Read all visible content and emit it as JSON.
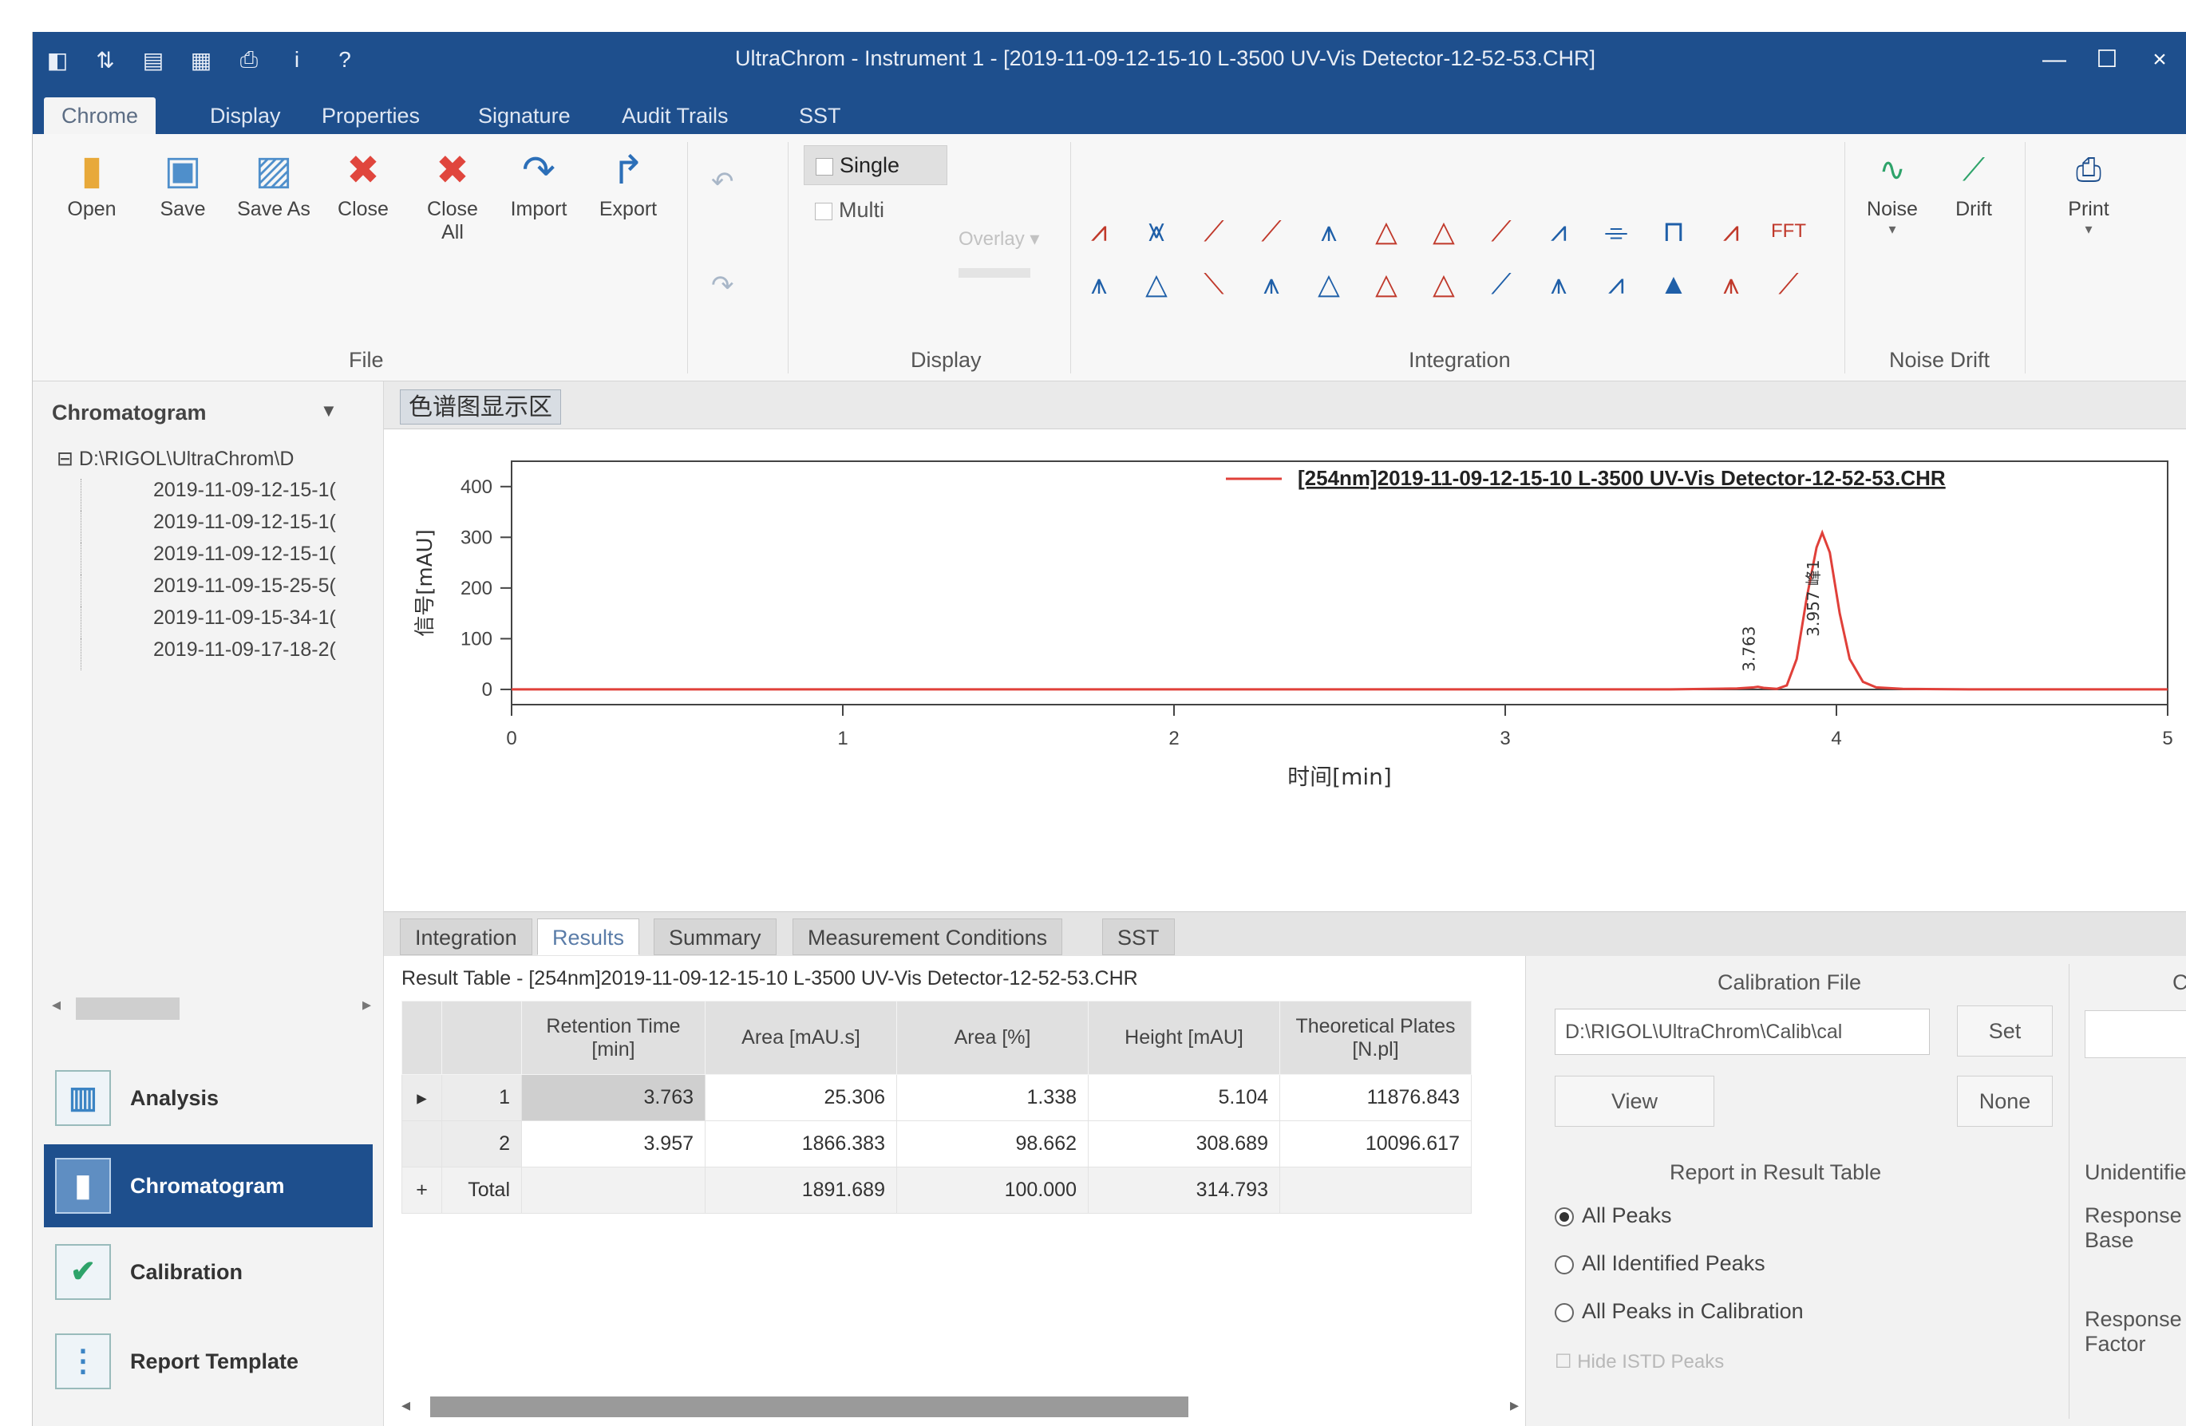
{
  "window": {
    "title": "UltraChrom - Instrument 1 - [2019-11-09-12-15-10 L-3500 UV-Vis Detector-12-52-53.CHR]",
    "qa_icons": [
      "app-icon",
      "new-icon",
      "open-icon",
      "layout-icon",
      "print-icon",
      "info-icon",
      "help-icon"
    ],
    "controls": [
      "—",
      "☐",
      "×"
    ]
  },
  "menu_tabs": [
    "Chrome",
    "Display",
    "Properties",
    "Signature",
    "Audit Trails",
    "SST"
  ],
  "ribbon": {
    "file_buttons": [
      {
        "label": "Open",
        "icon": "open-folder-icon"
      },
      {
        "label": "Save",
        "icon": "save-icon"
      },
      {
        "label": "Save As",
        "icon": "save-as-icon"
      },
      {
        "label": "Close",
        "icon": "close-icon"
      },
      {
        "label": "Close All",
        "icon": "close-all-icon"
      },
      {
        "label": "Import",
        "icon": "import-icon"
      },
      {
        "label": "Export",
        "icon": "export-icon"
      }
    ],
    "file_group": "File",
    "display": {
      "single": "Single",
      "multi": "Multi",
      "overlay": "Overlay",
      "group": "Display"
    },
    "integration_group": "Integration",
    "fft_label": "FFT",
    "noise_buttons": [
      {
        "label": "Noise",
        "icon": "noise-icon"
      },
      {
        "label": "Drift",
        "icon": "drift-icon"
      }
    ],
    "noise_group": "Noise Drift",
    "print": {
      "label": "Print",
      "icon": "print-icon"
    }
  },
  "left_panel": {
    "header": "Chromatogram",
    "tree_root": "D:\\RIGOL\\UltraChrom\\D",
    "tree_items": [
      "2019-11-09-12-15-1(",
      "2019-11-09-12-15-1(",
      "2019-11-09-12-15-1(",
      "2019-11-09-15-25-5(",
      "2019-11-09-15-34-1(",
      "2019-11-09-17-18-2("
    ],
    "nav": [
      {
        "label": "Analysis",
        "icon": "analysis-icon"
      },
      {
        "label": "Chromatogram",
        "icon": "chromatogram-icon"
      },
      {
        "label": "Calibration",
        "icon": "calibration-icon"
      },
      {
        "label": "Report Template",
        "icon": "report-template-icon"
      }
    ]
  },
  "doc_tab": "色谱图显示区",
  "chart_data": {
    "type": "line",
    "title": "",
    "legend": "[254nm]2019-11-09-12-15-10 L-3500 UV-Vis Detector-12-52-53.CHR",
    "legend_position": "top-right",
    "xlabel": "时间[min]",
    "ylabel": "信号[mAU]",
    "xlim": [
      0,
      5
    ],
    "ylim": [
      -30,
      450
    ],
    "x_ticks": [
      0,
      1,
      2,
      3,
      4,
      5
    ],
    "y_ticks": [
      0,
      100,
      200,
      300,
      400
    ],
    "series": [
      {
        "name": "[254nm]2019-11-09-12-15-10 L-3500 UV-Vis Detector-12-52-53.CHR",
        "color": "#e0403a",
        "x": [
          0,
          3.5,
          3.7,
          3.75,
          3.763,
          3.78,
          3.82,
          3.85,
          3.88,
          3.91,
          3.94,
          3.957,
          3.98,
          4.01,
          4.04,
          4.08,
          4.12,
          4.2,
          4.4,
          5.0
        ],
        "y": [
          0,
          0,
          2,
          4,
          5.1,
          3,
          1,
          8,
          60,
          180,
          280,
          309,
          270,
          150,
          60,
          15,
          4,
          1,
          0,
          0
        ]
      }
    ],
    "peak_labels": [
      {
        "x": 3.763,
        "text": "3.763"
      },
      {
        "x": 3.957,
        "text": "3.957 峰1"
      }
    ]
  },
  "result_tabs": [
    "Integration",
    "Results",
    "Summary",
    "Measurement Conditions",
    "SST"
  ],
  "result_table": {
    "title": "Result Table - [254nm]2019-11-09-12-15-10 L-3500 UV-Vis Detector-12-52-53.CHR",
    "columns": [
      "",
      "",
      "Retention Time [min]",
      "Area [mAU.s]",
      "Area [%]",
      "Height [mAU]",
      "Theoretical Plates [N.pl]"
    ],
    "rows": [
      {
        "marker": "▸",
        "idx": "1",
        "rt": "3.763",
        "area": "25.306",
        "area_pct": "1.338",
        "height": "5.104",
        "plates": "11876.843"
      },
      {
        "marker": "",
        "idx": "2",
        "rt": "3.957",
        "area": "1866.383",
        "area_pct": "98.662",
        "height": "308.689",
        "plates": "10096.617"
      },
      {
        "marker": "+",
        "idx": "Total",
        "rt": "",
        "area": "1891.689",
        "area_pct": "100.000",
        "height": "314.793",
        "plates": ""
      }
    ]
  },
  "calibration": {
    "title": "Calibration File",
    "path": "D:\\RIGOL\\UltraChrom\\Calib\\cal",
    "set": "Set",
    "view": "View",
    "none": "None",
    "report_title": "Report in Result Table",
    "options": [
      "All Peaks",
      "All Identified Peaks",
      "All Peaks in Calibration"
    ],
    "hide_istd": "Hide ISTD Peaks",
    "side_title": "Unidentified",
    "side_c": "C",
    "response_base": "Response Base",
    "response_factor": "Response Factor"
  }
}
